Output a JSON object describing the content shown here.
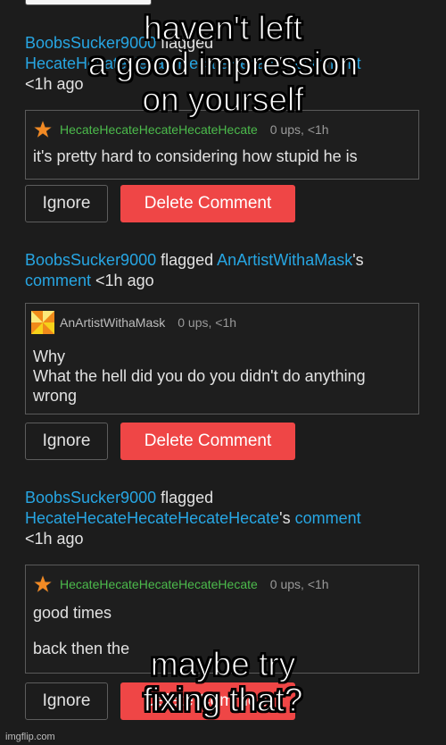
{
  "flags": [
    {
      "flagger": "BoobsSucker9000",
      "verb": " flagged ",
      "target": "HecateHecateHecateHecateHecate",
      "possessive": "'s ",
      "comment_link": "comment",
      "time": "<1h ago",
      "card": {
        "avatar": "star-icon",
        "author": "HecateHecateHecateHecateHecate",
        "meta": "0 ups, <1h",
        "body": "it's pretty hard to considering how stupid he is"
      }
    },
    {
      "flagger": "BoobsSucker9000",
      "verb": " flagged ",
      "target": "AnArtistWithaMask",
      "possessive": "'s",
      "comment_link": "comment",
      "time": " <1h ago",
      "card": {
        "avatar": "pinwheel-icon",
        "author": "AnArtistWithaMask",
        "meta": "0 ups, <1h",
        "body_line1": "Why",
        "body_line2": "What the hell did you do you didn't do anything wrong"
      }
    },
    {
      "flagger": "BoobsSucker9000",
      "verb": " flagged",
      "target": "HecateHecateHecateHecateHecate",
      "possessive": "'s ",
      "comment_link": "comment",
      "time": "<1h ago",
      "card": {
        "avatar": "star-icon",
        "author": "HecateHecateHecateHecateHecate",
        "meta": "0 ups, <1h",
        "body_line1": "good times",
        "body_line2": "back then the"
      }
    }
  ],
  "buttons": {
    "ignore": "Ignore",
    "delete": "Delete Comment"
  },
  "meme": {
    "top_line1": "haven't left",
    "top_line2": "a good impression",
    "top_line3": "on yourself",
    "bottom_line1": "maybe try",
    "bottom_line2": "fixing that?"
  },
  "watermark": "imgflip.com",
  "colors": {
    "link": "#27a6e3",
    "delete": "#ef4646",
    "green_author": "#4cbb4c",
    "background": "#1c1c1c"
  }
}
